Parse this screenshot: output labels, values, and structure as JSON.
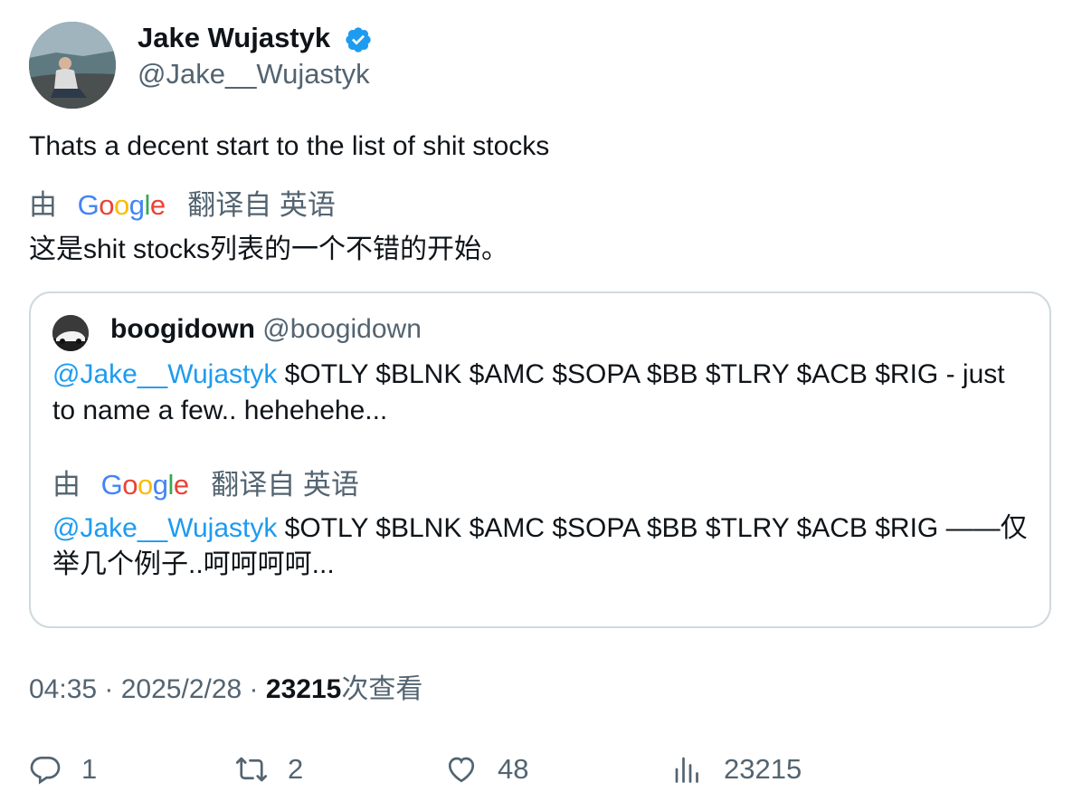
{
  "author": {
    "name": "Jake Wujastyk",
    "handle": "@Jake__Wujastyk",
    "verified_icon": "verified-badge-icon",
    "verified_color": "#1d9bf0"
  },
  "tweet": {
    "text": "Thats a decent start to the list of shit stocks",
    "translation": {
      "by": "由",
      "provider": "Google",
      "from_label": "翻译自 英语",
      "text": "这是shit stocks列表的一个不错的开始。"
    }
  },
  "quote": {
    "name": "boogidown",
    "handle": "@boogidown",
    "mention": "@Jake__Wujastyk",
    "text_rest": " $OTLY $BLNK $AMC $SOPA $BB $TLRY $ACB $RIG - just to name a few.. hehehehe...",
    "translation": {
      "by": "由",
      "provider": "Google",
      "from_label": "翻译自 英语",
      "mention": "@Jake__Wujastyk",
      "text_rest": " $OTLY $BLNK $AMC $SOPA $BB $TLRY $ACB $RIG ——仅举几个例子..呵呵呵呵..."
    }
  },
  "meta": {
    "time": "04:35",
    "sep": " · ",
    "date": "2025/2/28",
    "views_count": "23215",
    "views_label": "次查看"
  },
  "actions": {
    "replies": "1",
    "retweets": "2",
    "likes": "48",
    "views": "23215"
  },
  "colors": {
    "accent": "#1d9bf0",
    "secondary_text": "#536471",
    "border": "#cfd9de"
  }
}
